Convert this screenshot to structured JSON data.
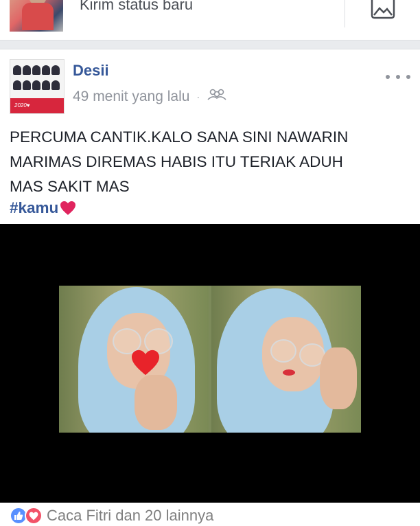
{
  "composer": {
    "prompt": "Kirim status baru",
    "photo_icon": "photo-icon"
  },
  "post": {
    "author": "Desii",
    "time": "49 menit yang lalu",
    "separator": "·",
    "audience_icon": "friends-audience-icon",
    "more_icon": "more-options-icon",
    "text_lines": [
      "PERCUMA CANTIK.KALO SANA SINI NAWARIN",
      "MARIMAS DIREMAS HABIS ITU TERIAK ADUH",
      "MAS SAKIT MAS"
    ],
    "hashtag": "#kamu",
    "hashtag_emoji": "red-heart-icon",
    "avatar_caption": "2020♥"
  },
  "reactions": {
    "icons": [
      "like-icon",
      "love-icon"
    ],
    "summary": "Caca Fitri dan 20 lainnya"
  },
  "colors": {
    "link_blue": "#365899",
    "meta_gray": "#90949c",
    "like_blue": "#5890ff",
    "love_red": "#f25268"
  }
}
